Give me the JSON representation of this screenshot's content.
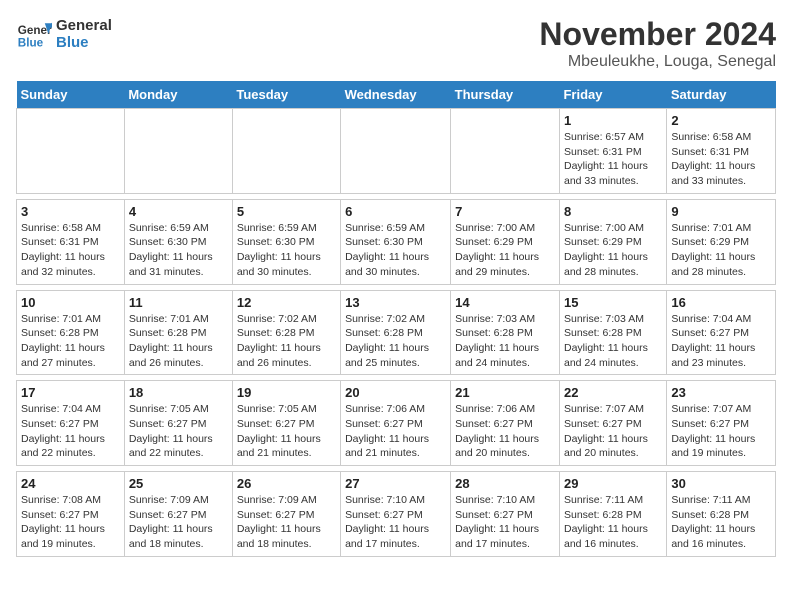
{
  "logo": {
    "text_general": "General",
    "text_blue": "Blue"
  },
  "title": "November 2024",
  "subtitle": "Mbeuleukhe, Louga, Senegal",
  "days_of_week": [
    "Sunday",
    "Monday",
    "Tuesday",
    "Wednesday",
    "Thursday",
    "Friday",
    "Saturday"
  ],
  "weeks": [
    [
      {
        "day": "",
        "info": ""
      },
      {
        "day": "",
        "info": ""
      },
      {
        "day": "",
        "info": ""
      },
      {
        "day": "",
        "info": ""
      },
      {
        "day": "",
        "info": ""
      },
      {
        "day": "1",
        "info": "Sunrise: 6:57 AM\nSunset: 6:31 PM\nDaylight: 11 hours and 33 minutes."
      },
      {
        "day": "2",
        "info": "Sunrise: 6:58 AM\nSunset: 6:31 PM\nDaylight: 11 hours and 33 minutes."
      }
    ],
    [
      {
        "day": "3",
        "info": "Sunrise: 6:58 AM\nSunset: 6:31 PM\nDaylight: 11 hours and 32 minutes."
      },
      {
        "day": "4",
        "info": "Sunrise: 6:59 AM\nSunset: 6:30 PM\nDaylight: 11 hours and 31 minutes."
      },
      {
        "day": "5",
        "info": "Sunrise: 6:59 AM\nSunset: 6:30 PM\nDaylight: 11 hours and 30 minutes."
      },
      {
        "day": "6",
        "info": "Sunrise: 6:59 AM\nSunset: 6:30 PM\nDaylight: 11 hours and 30 minutes."
      },
      {
        "day": "7",
        "info": "Sunrise: 7:00 AM\nSunset: 6:29 PM\nDaylight: 11 hours and 29 minutes."
      },
      {
        "day": "8",
        "info": "Sunrise: 7:00 AM\nSunset: 6:29 PM\nDaylight: 11 hours and 28 minutes."
      },
      {
        "day": "9",
        "info": "Sunrise: 7:01 AM\nSunset: 6:29 PM\nDaylight: 11 hours and 28 minutes."
      }
    ],
    [
      {
        "day": "10",
        "info": "Sunrise: 7:01 AM\nSunset: 6:28 PM\nDaylight: 11 hours and 27 minutes."
      },
      {
        "day": "11",
        "info": "Sunrise: 7:01 AM\nSunset: 6:28 PM\nDaylight: 11 hours and 26 minutes."
      },
      {
        "day": "12",
        "info": "Sunrise: 7:02 AM\nSunset: 6:28 PM\nDaylight: 11 hours and 26 minutes."
      },
      {
        "day": "13",
        "info": "Sunrise: 7:02 AM\nSunset: 6:28 PM\nDaylight: 11 hours and 25 minutes."
      },
      {
        "day": "14",
        "info": "Sunrise: 7:03 AM\nSunset: 6:28 PM\nDaylight: 11 hours and 24 minutes."
      },
      {
        "day": "15",
        "info": "Sunrise: 7:03 AM\nSunset: 6:28 PM\nDaylight: 11 hours and 24 minutes."
      },
      {
        "day": "16",
        "info": "Sunrise: 7:04 AM\nSunset: 6:27 PM\nDaylight: 11 hours and 23 minutes."
      }
    ],
    [
      {
        "day": "17",
        "info": "Sunrise: 7:04 AM\nSunset: 6:27 PM\nDaylight: 11 hours and 22 minutes."
      },
      {
        "day": "18",
        "info": "Sunrise: 7:05 AM\nSunset: 6:27 PM\nDaylight: 11 hours and 22 minutes."
      },
      {
        "day": "19",
        "info": "Sunrise: 7:05 AM\nSunset: 6:27 PM\nDaylight: 11 hours and 21 minutes."
      },
      {
        "day": "20",
        "info": "Sunrise: 7:06 AM\nSunset: 6:27 PM\nDaylight: 11 hours and 21 minutes."
      },
      {
        "day": "21",
        "info": "Sunrise: 7:06 AM\nSunset: 6:27 PM\nDaylight: 11 hours and 20 minutes."
      },
      {
        "day": "22",
        "info": "Sunrise: 7:07 AM\nSunset: 6:27 PM\nDaylight: 11 hours and 20 minutes."
      },
      {
        "day": "23",
        "info": "Sunrise: 7:07 AM\nSunset: 6:27 PM\nDaylight: 11 hours and 19 minutes."
      }
    ],
    [
      {
        "day": "24",
        "info": "Sunrise: 7:08 AM\nSunset: 6:27 PM\nDaylight: 11 hours and 19 minutes."
      },
      {
        "day": "25",
        "info": "Sunrise: 7:09 AM\nSunset: 6:27 PM\nDaylight: 11 hours and 18 minutes."
      },
      {
        "day": "26",
        "info": "Sunrise: 7:09 AM\nSunset: 6:27 PM\nDaylight: 11 hours and 18 minutes."
      },
      {
        "day": "27",
        "info": "Sunrise: 7:10 AM\nSunset: 6:27 PM\nDaylight: 11 hours and 17 minutes."
      },
      {
        "day": "28",
        "info": "Sunrise: 7:10 AM\nSunset: 6:27 PM\nDaylight: 11 hours and 17 minutes."
      },
      {
        "day": "29",
        "info": "Sunrise: 7:11 AM\nSunset: 6:28 PM\nDaylight: 11 hours and 16 minutes."
      },
      {
        "day": "30",
        "info": "Sunrise: 7:11 AM\nSunset: 6:28 PM\nDaylight: 11 hours and 16 minutes."
      }
    ]
  ]
}
